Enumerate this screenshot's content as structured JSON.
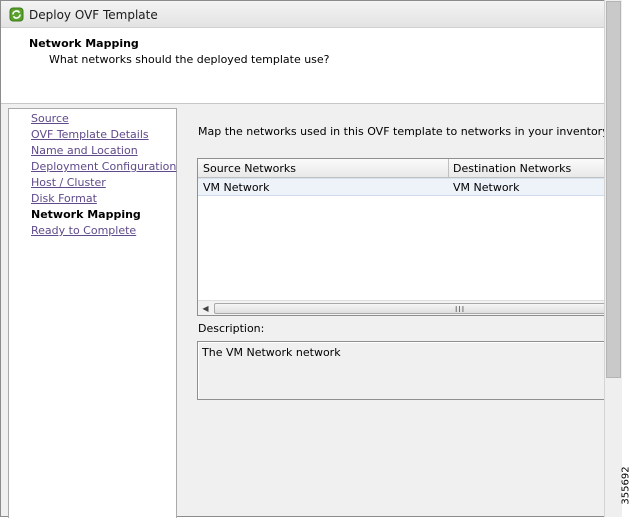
{
  "window": {
    "title": "Deploy OVF Template",
    "icon": "ovf-template-icon"
  },
  "header": {
    "title": "Network Mapping",
    "subtitle": "What networks should the deployed template use?"
  },
  "nav": {
    "items": [
      {
        "label": "Source",
        "state": "link"
      },
      {
        "label": "OVF Template Details",
        "state": "link"
      },
      {
        "label": "Name and Location",
        "state": "link"
      },
      {
        "label": "Deployment Configuration",
        "state": "link"
      },
      {
        "label": "Host / Cluster",
        "state": "link"
      },
      {
        "label": "Disk Format",
        "state": "link"
      },
      {
        "label": "Network Mapping",
        "state": "current"
      },
      {
        "label": "Ready to Complete",
        "state": "link"
      }
    ]
  },
  "main": {
    "intro": "Map the networks used in this OVF template to networks in your inventory",
    "table": {
      "columns": [
        "Source Networks",
        "Destination Networks"
      ],
      "rows": [
        [
          "VM Network",
          "VM Network"
        ]
      ]
    },
    "scroll_grip": "III",
    "description_label": "Description:",
    "description_text": "The VM Network network"
  },
  "figure_id": "355692",
  "colors": {
    "link": "#5f4a8b",
    "selected_row": "#eef3fa",
    "icon_green": "#5aa02c"
  }
}
